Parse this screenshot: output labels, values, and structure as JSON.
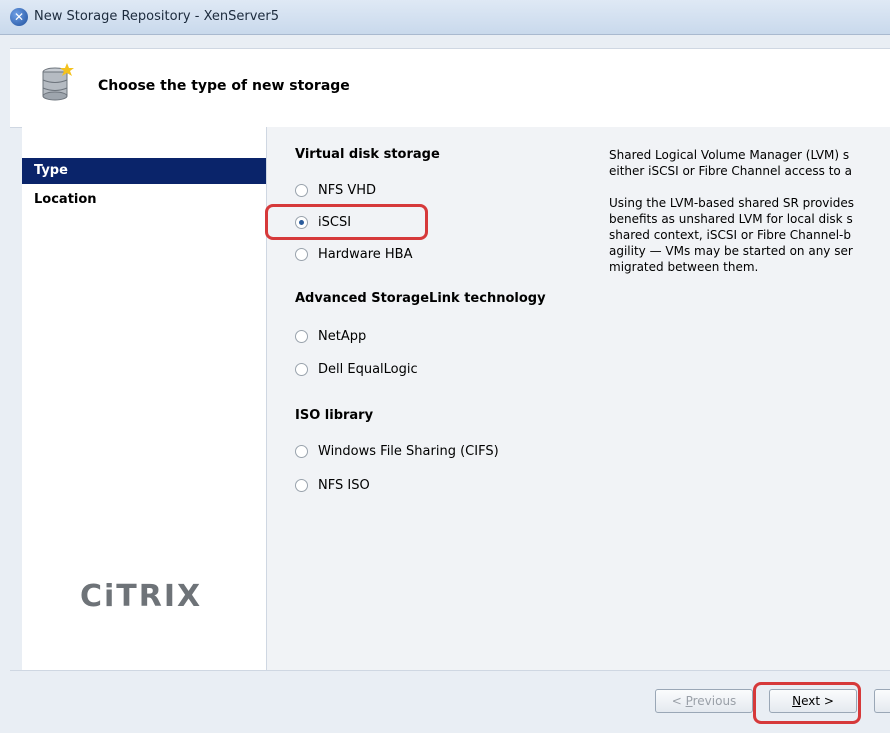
{
  "window": {
    "title": "New Storage Repository - XenServer5",
    "icon": "xenserver-app-icon"
  },
  "header": {
    "title": "Choose the type of new storage",
    "icon": "storage-database-icon"
  },
  "nav": {
    "items": [
      {
        "label": "Type",
        "selected": true
      },
      {
        "label": "Location",
        "selected": false
      }
    ],
    "logo_text": "CiTRIX"
  },
  "options": {
    "virtual_disk_label": "Virtual disk storage",
    "virtual_disk": [
      {
        "label": "NFS VHD",
        "checked": false
      },
      {
        "label": "iSCSI",
        "checked": true
      },
      {
        "label": "Hardware HBA",
        "checked": false
      }
    ],
    "storagelink_label": "Advanced StorageLink technology",
    "storagelink": [
      {
        "label": "NetApp",
        "checked": false
      },
      {
        "label": "Dell EqualLogic",
        "checked": false
      }
    ],
    "iso_label": "ISO library",
    "iso": [
      {
        "label": "Windows File Sharing (CIFS)",
        "checked": false
      },
      {
        "label": "NFS ISO",
        "checked": false
      }
    ]
  },
  "description": {
    "para1_line1": "Shared Logical Volume Manager (LVM) s",
    "para1_line2": "either iSCSI or Fibre Channel access to a",
    "para2_line1": "Using the LVM-based shared SR provides",
    "para2_line2": "benefits as unshared LVM for local disk s",
    "para2_line3": "shared context, iSCSI or Fibre Channel-b",
    "para2_line4": "agility — VMs may be started on any ser",
    "para2_line5": "migrated between them."
  },
  "buttons": {
    "previous_prefix": "< ",
    "previous_accel": "P",
    "previous_rest": "revious",
    "next_accel": "N",
    "next_rest": "ext >"
  },
  "colors": {
    "selected_nav": "#0a246a",
    "highlight": "#d6393a"
  }
}
